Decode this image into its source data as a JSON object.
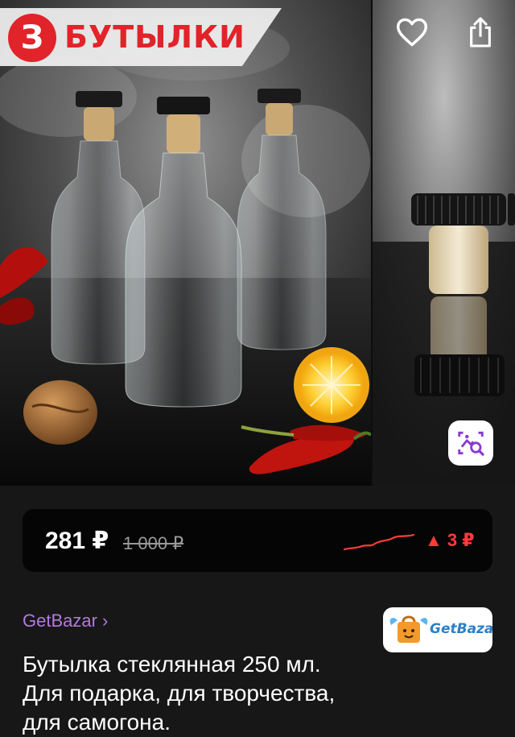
{
  "gallery": {
    "brand_logo_letter": "З",
    "brand_name": "БУТЫЛКИ",
    "favorite_icon": "heart-outline-icon",
    "share_icon": "share-upload-icon",
    "visual_search_icon": "image-search-icon"
  },
  "price": {
    "current": "281 ₽",
    "old": "1 000 ₽",
    "change": "▲ 3 ₽",
    "trend_color": "#ff3b3b"
  },
  "seller": {
    "link_label": "GetBazar ›",
    "logo_text": "GetBazar"
  },
  "product": {
    "title": "Бутылка стеклянная 250 мл. Для подарка, для творчества, для самогона."
  },
  "colors": {
    "background": "#171717",
    "accent_purple": "#b07ae0",
    "brand_red": "#e1232a"
  }
}
